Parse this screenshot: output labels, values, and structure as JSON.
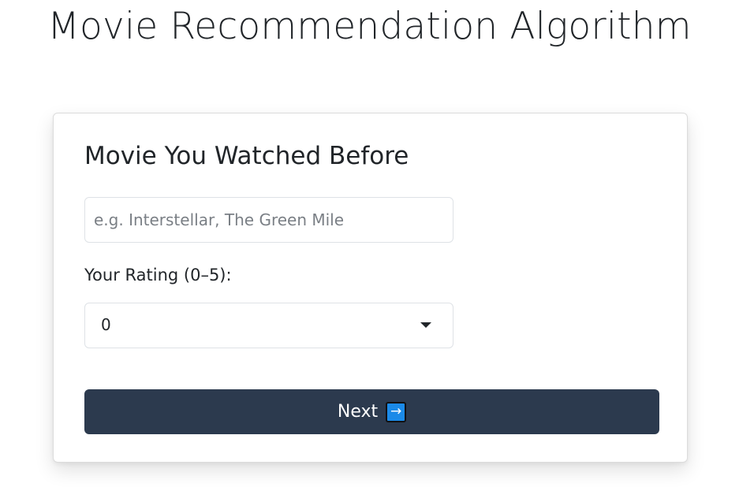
{
  "app": {
    "title": "Movie Recommendation Algorithm"
  },
  "card": {
    "title": "Movie You Watched Before",
    "movie_input": {
      "placeholder": "e.g. Interstellar, The Green Mile",
      "value": ""
    },
    "rating": {
      "label": "Your Rating (0–5):",
      "selected": "0"
    },
    "next_button": {
      "label": "Next",
      "icon": "arrow-right-icon",
      "icon_glyph": "→",
      "color": "#2c3a4e"
    }
  }
}
